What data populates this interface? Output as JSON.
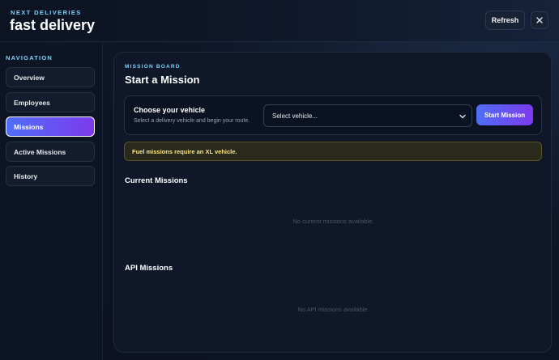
{
  "header": {
    "eyebrow": "NEXT DELIVERIES",
    "title": "fast delivery",
    "refresh_label": "Refresh",
    "close_icon": "close-icon"
  },
  "sidebar": {
    "heading": "NAVIGATION",
    "items": [
      {
        "label": "Overview",
        "active": false
      },
      {
        "label": "Employees",
        "active": false
      },
      {
        "label": "Missions",
        "active": true
      },
      {
        "label": "Active Missions",
        "active": false
      },
      {
        "label": "History",
        "active": false
      }
    ]
  },
  "main": {
    "eyebrow": "MISSION BOARD",
    "title": "Start a Mission",
    "vehicle_card": {
      "title": "Choose your vehicle",
      "subtitle": "Select a delivery vehicle and begin your route.",
      "select_value": "Select vehicle...",
      "start_label": "Start Mission"
    },
    "alert": "Fuel missions require an XL vehicle.",
    "current_missions": {
      "title": "Current Missions",
      "empty": "No current missions available."
    },
    "api_missions": {
      "title": "API Missions",
      "empty": "No API missions available."
    }
  },
  "colors": {
    "accent_start": "#4f6ef7",
    "accent_end": "#7c3aed",
    "eyebrow": "#7dd3fc",
    "alert_text": "#fde68a"
  }
}
